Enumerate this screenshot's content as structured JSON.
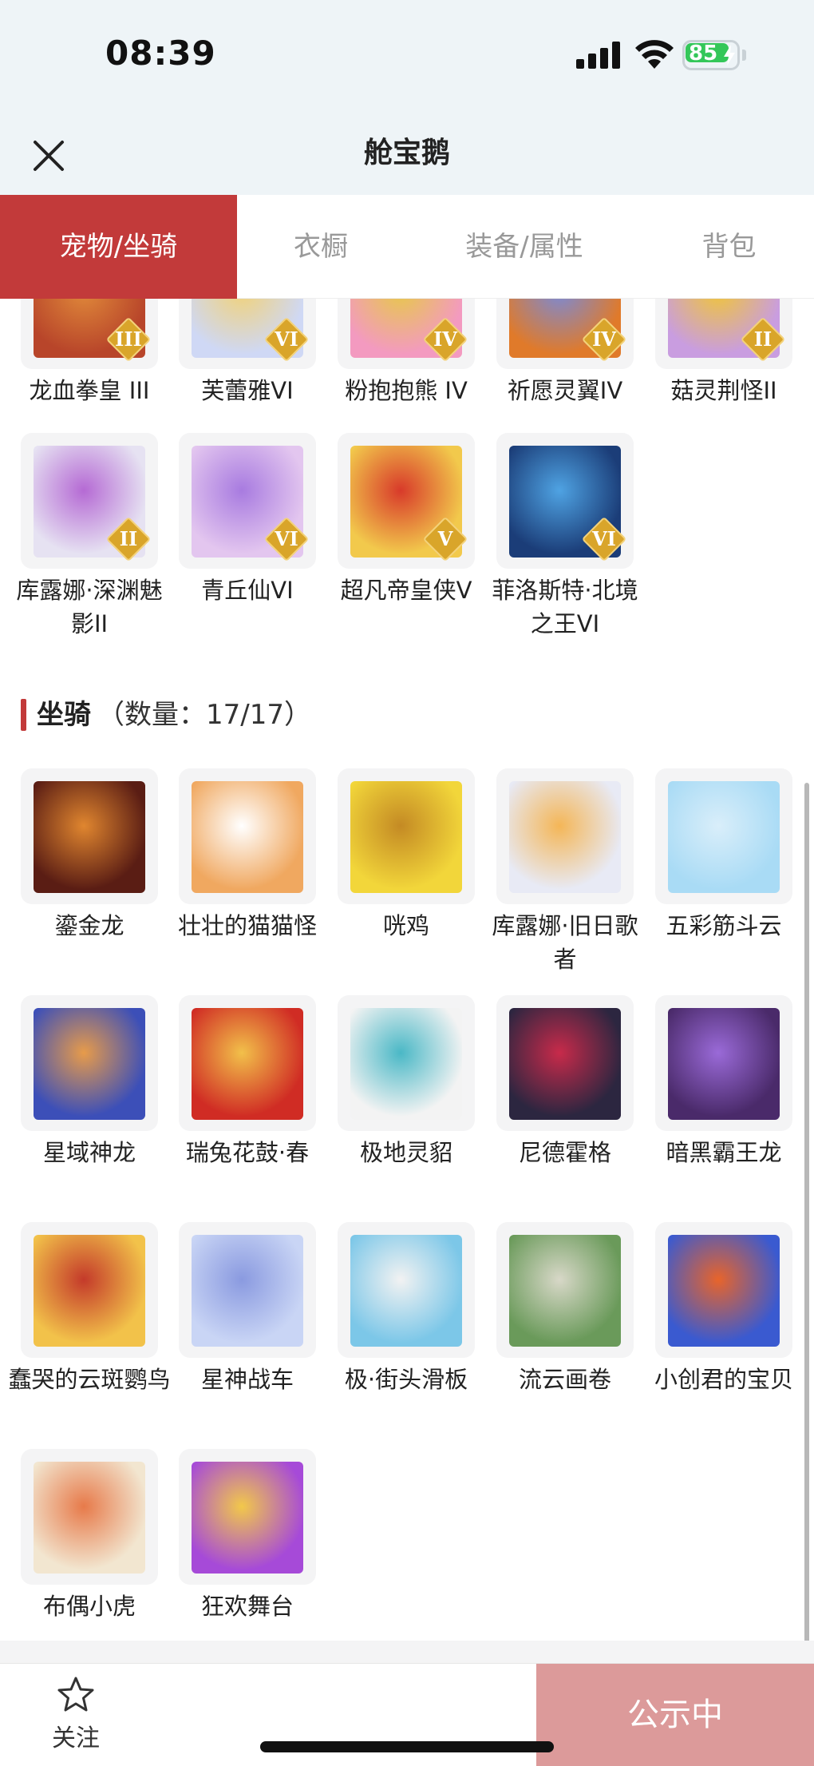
{
  "status_bar": {
    "time": "08:39",
    "battery": "85"
  },
  "header": {
    "title": "舱宝鹅"
  },
  "tabs": [
    {
      "label": "宠物/坐骑",
      "active": true
    },
    {
      "label": "衣橱",
      "active": false
    },
    {
      "label": "装备/属性",
      "active": false
    },
    {
      "label": "背包",
      "active": false
    }
  ],
  "pets": [
    {
      "label": "龙血拳皇 III",
      "badge": "III",
      "colors": [
        "#b8452a",
        "#e0893a"
      ]
    },
    {
      "label": "芙蕾雅VI",
      "badge": "VI",
      "colors": [
        "#cfd8f5",
        "#f1d27a"
      ]
    },
    {
      "label": "粉抱抱熊 IV",
      "badge": "IV",
      "colors": [
        "#f39ac0",
        "#e7c84b"
      ]
    },
    {
      "label": "祈愿灵翼IV",
      "badge": "IV",
      "colors": [
        "#e07a2a",
        "#7a8ad6"
      ]
    },
    {
      "label": "菇灵荆怪II",
      "badge": "II",
      "colors": [
        "#c99de0",
        "#f0c53a"
      ]
    },
    {
      "label": "库露娜·深渊魅影II",
      "badge": "II",
      "colors": [
        "#e6e2f2",
        "#b56ad4"
      ]
    },
    {
      "label": "青丘仙VI",
      "badge": "VI",
      "colors": [
        "#e3c6ef",
        "#a87be0"
      ]
    },
    {
      "label": "超凡帝皇侠V",
      "badge": "V",
      "colors": [
        "#f2c94c",
        "#d83a2a"
      ]
    },
    {
      "label": "菲洛斯特·北境之王VI",
      "badge": "VI",
      "colors": [
        "#1b3d78",
        "#4fa3e3"
      ]
    }
  ],
  "mounts_section": {
    "title": "坐骑",
    "count": "（数量：17/17）"
  },
  "mounts": [
    {
      "label": "鎏金龙",
      "colors": [
        "#5a1d14",
        "#e0862f"
      ]
    },
    {
      "label": "壮壮的猫猫怪",
      "colors": [
        "#f0a860",
        "#ffffff"
      ]
    },
    {
      "label": "咣鸡",
      "colors": [
        "#f2d63a",
        "#c48a24"
      ]
    },
    {
      "label": "库露娜·旧日歌者",
      "colors": [
        "#e8eaf5",
        "#f4b657"
      ]
    },
    {
      "label": "五彩筋斗云",
      "colors": [
        "#a9dbf5",
        "#d9eefa"
      ]
    },
    {
      "label": "星域神龙",
      "colors": [
        "#3c4fb8",
        "#e79b4a"
      ]
    },
    {
      "label": "瑞兔花鼓·春",
      "colors": [
        "#d02c24",
        "#f2c04a"
      ]
    },
    {
      "label": "极地灵貂",
      "colors": [
        "#f3f3f3",
        "#4ab8c6"
      ]
    },
    {
      "label": "尼德霍格",
      "colors": [
        "#2c2640",
        "#c82a4a"
      ]
    },
    {
      "label": "暗黑霸王龙",
      "colors": [
        "#4a2a6a",
        "#9a6ad8"
      ]
    },
    {
      "label": "蠢哭的云斑鹦鸟",
      "colors": [
        "#f2c24a",
        "#c43a2a"
      ]
    },
    {
      "label": "星神战车",
      "colors": [
        "#c9d5f5",
        "#8a9ae0"
      ]
    },
    {
      "label": "极·街头滑板",
      "colors": [
        "#7cc7e8",
        "#f2f2f2"
      ]
    },
    {
      "label": "流云画卷",
      "colors": [
        "#6a9a5a",
        "#d8d8c8"
      ]
    },
    {
      "label": "小创君的宝贝",
      "colors": [
        "#3a5ad0",
        "#e8642a"
      ]
    },
    {
      "label": "布偶小虎",
      "colors": [
        "#f2e6d0",
        "#e77a4a"
      ]
    },
    {
      "label": "狂欢舞台",
      "colors": [
        "#a64ad8",
        "#f2c84a"
      ]
    }
  ],
  "bottom_bar": {
    "follow_label": "关注",
    "status_button": "公示中"
  },
  "colors": {
    "accent": "#c23a3a",
    "status_button": "#dc9a9a",
    "battery": "#34c759"
  }
}
